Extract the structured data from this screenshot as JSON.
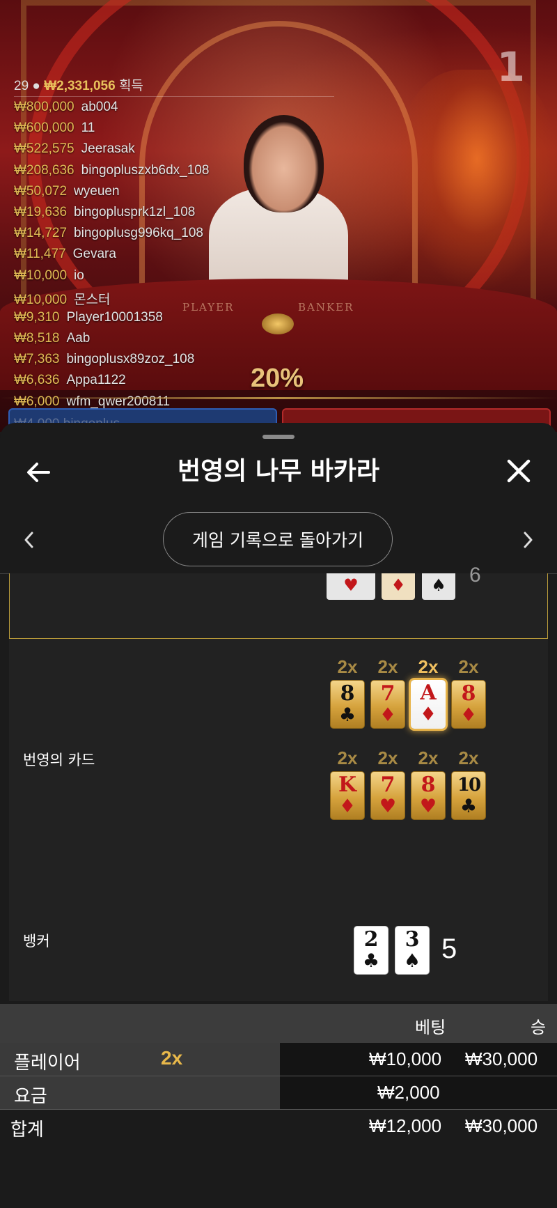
{
  "live": {
    "round_number": "1",
    "player_count": "29",
    "total_win": "₩2,331,056",
    "win_suffix": "획득",
    "winners": [
      {
        "amount": "₩800,000",
        "name": "ab004"
      },
      {
        "amount": "₩600,000",
        "name": "11"
      },
      {
        "amount": "₩522,575",
        "name": "Jeerasak"
      },
      {
        "amount": "₩208,636",
        "name": "bingopluszxb6dx_108"
      },
      {
        "amount": "₩50,072",
        "name": "wyeuen"
      },
      {
        "amount": "₩19,636",
        "name": "bingoplusprk1zl_108"
      },
      {
        "amount": "₩14,727",
        "name": "bingoplusg996kq_108"
      },
      {
        "amount": "₩11,477",
        "name": "Gevara"
      },
      {
        "amount": "₩10,000",
        "name": "io"
      },
      {
        "amount": "₩10,000",
        "name": "몬스터"
      },
      {
        "amount": "₩9,310",
        "name": "Player10001358"
      },
      {
        "amount": "₩8,518",
        "name": "Aab"
      },
      {
        "amount": "₩7,363",
        "name": "bingoplusx89zoz_108"
      },
      {
        "amount": "₩6,636",
        "name": "Appa1122"
      },
      {
        "amount": "₩6,000",
        "name": "wfm_qwer200811"
      }
    ],
    "ghost_row": "₩4,000 bingoplus...",
    "table_player_label": "PLAYER",
    "table_banker_label": "BANKER",
    "commission_pct": "20%"
  },
  "sheet": {
    "title": "번영의 나무 바카라",
    "back_icon": "arrow-left-icon",
    "close_icon": "close-icon",
    "history_button": "게임 기록으로 돌아가기"
  },
  "result": {
    "partial_top_score": "6",
    "prosperity_label": "번영의 카드",
    "prosperity_row1": [
      {
        "mult": "2x",
        "rank": "8",
        "suit": "♣",
        "color": "black"
      },
      {
        "mult": "2x",
        "rank": "7",
        "suit": "♦",
        "color": "red"
      },
      {
        "mult": "2x",
        "rank": "A",
        "suit": "♦",
        "color": "red",
        "highlight": true
      },
      {
        "mult": "2x",
        "rank": "8",
        "suit": "♦",
        "color": "red"
      }
    ],
    "prosperity_row2": [
      {
        "mult": "2x",
        "rank": "K",
        "suit": "♦",
        "color": "red"
      },
      {
        "mult": "2x",
        "rank": "7",
        "suit": "♥",
        "color": "red"
      },
      {
        "mult": "2x",
        "rank": "8",
        "suit": "♥",
        "color": "red"
      },
      {
        "mult": "2x",
        "rank": "10",
        "suit": "♣",
        "color": "black"
      }
    ],
    "banker_label": "뱅커",
    "banker_cards": [
      {
        "rank": "2",
        "suit": "♣"
      },
      {
        "rank": "3",
        "suit": "♠"
      }
    ],
    "banker_score": "5"
  },
  "bets": {
    "col_bet": "베팅",
    "col_win": "승",
    "rows": [
      {
        "label": "플레이어",
        "mult": "2x",
        "bet": "₩10,000",
        "win": "₩30,000"
      },
      {
        "label": "요금",
        "mult": "",
        "bet": "₩2,000",
        "win": ""
      }
    ],
    "total_label": "합계",
    "total_bet": "₩12,000",
    "total_win": "₩30,000"
  },
  "colors": {
    "gold": "#e2bb55",
    "card_red": "#c2171a",
    "panel_bg": "#222222",
    "sheet_bg": "#1b1b1b"
  }
}
